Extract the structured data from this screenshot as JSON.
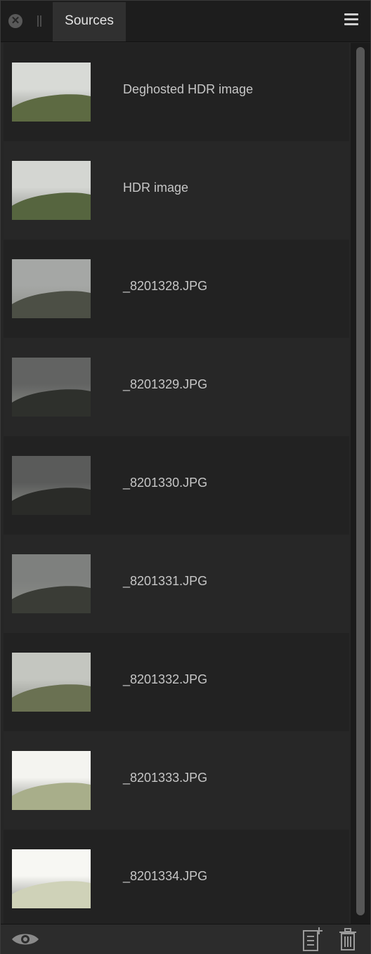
{
  "panel": {
    "tab_label": "Sources"
  },
  "sources": [
    {
      "name": "Deghosted HDR image",
      "sky": "#d8dad6",
      "hill": "#5d6a42"
    },
    {
      "name": "HDR image",
      "sky": "#d4d6d2",
      "hill": "#56653f"
    },
    {
      "name": "_8201328.JPG",
      "sky": "#a5a7a5",
      "hill": "#4c4f45"
    },
    {
      "name": "_8201329.JPG",
      "sky": "#626362",
      "hill": "#2e302c"
    },
    {
      "name": "_8201330.JPG",
      "sky": "#5a5b5a",
      "hill": "#2a2b28"
    },
    {
      "name": "_8201331.JPG",
      "sky": "#7e807e",
      "hill": "#3a3c36"
    },
    {
      "name": "_8201332.JPG",
      "sky": "#c4c6c0",
      "hill": "#6a7152"
    },
    {
      "name": "_8201333.JPG",
      "sky": "#f4f4f0",
      "hill": "#a8ae8a"
    },
    {
      "name": "_8201334.JPG",
      "sky": "#f7f7f3",
      "hill": "#cfd2b8"
    }
  ],
  "icons": {
    "close": "close-icon",
    "menu": "hamburger-menu-icon",
    "visibility": "eye-icon",
    "add": "add-document-icon",
    "delete": "trash-icon"
  }
}
